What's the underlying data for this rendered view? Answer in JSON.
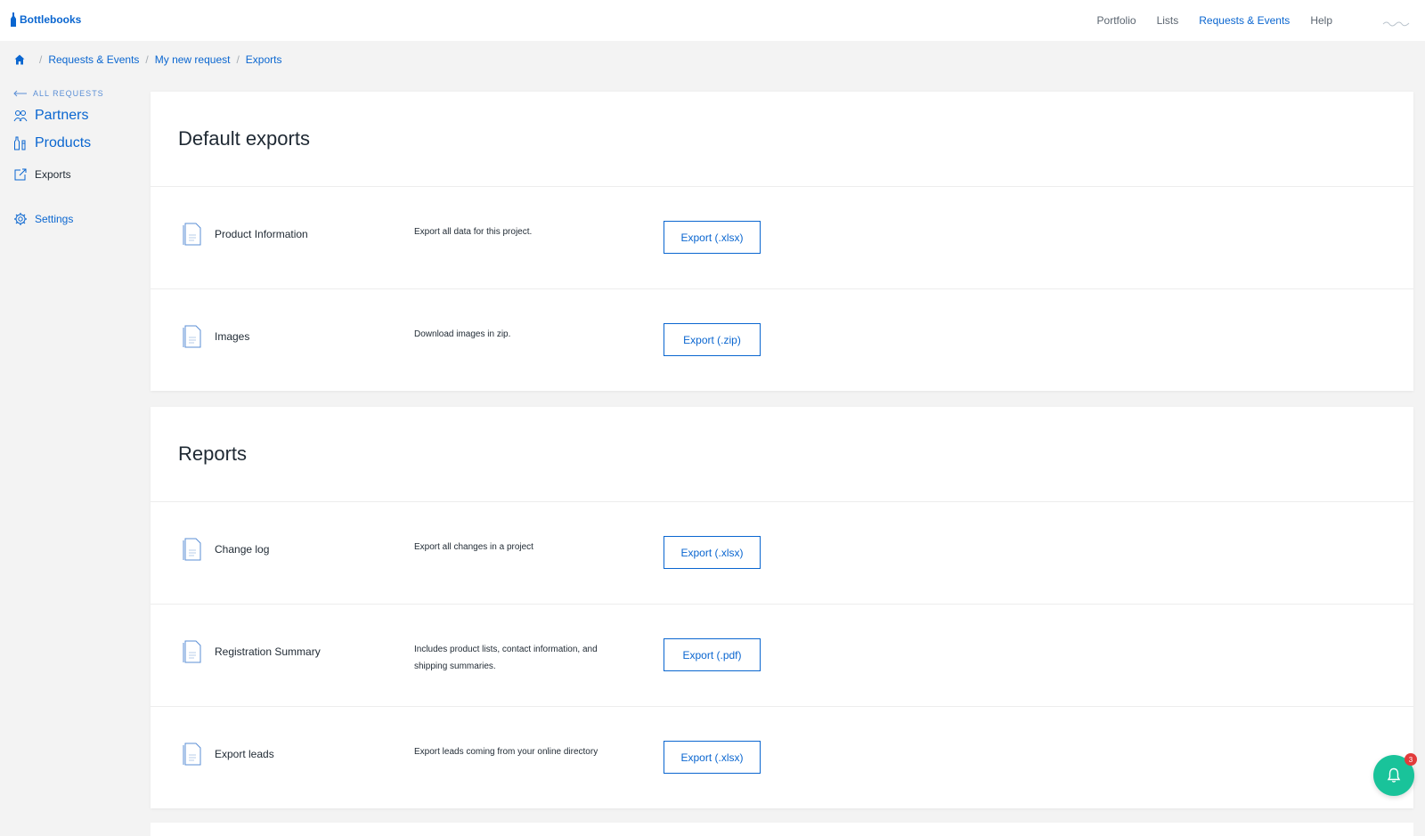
{
  "brand": {
    "name": "Bottlebooks"
  },
  "nav": {
    "items": [
      {
        "label": "Portfolio",
        "active": false
      },
      {
        "label": "Lists",
        "active": false
      },
      {
        "label": "Requests & Events",
        "active": true
      },
      {
        "label": "Help",
        "active": false
      }
    ]
  },
  "breadcrumb": {
    "items": [
      "Requests & Events",
      "My new request",
      "Exports"
    ]
  },
  "sidebar": {
    "back_label": "ALL REQUESTS",
    "items": [
      {
        "label": "Partners",
        "icon": "users-icon"
      },
      {
        "label": "Products",
        "icon": "bottles-icon"
      },
      {
        "label": "Exports",
        "icon": "export-icon"
      },
      {
        "label": "Settings",
        "icon": "gear-icon"
      }
    ]
  },
  "sections": [
    {
      "title": "Default exports",
      "rows": [
        {
          "name": "Product Information",
          "desc": "Export all data for this project.",
          "button": "Export (.xlsx)"
        },
        {
          "name": "Images",
          "desc": "Download images in zip.",
          "button": "Export (.zip)"
        }
      ]
    },
    {
      "title": "Reports",
      "rows": [
        {
          "name": "Change log",
          "desc": "Export all changes in a project",
          "button": "Export (.xlsx)"
        },
        {
          "name": "Registration Summary",
          "desc": "Includes product lists, contact information, and shipping summaries.",
          "button": "Export (.pdf)"
        },
        {
          "name": "Export leads",
          "desc": "Export leads coming from your online directory",
          "button": "Export (.xlsx)"
        }
      ]
    }
  ],
  "notifications": {
    "count": "3"
  },
  "colors": {
    "accent": "#0a66d0",
    "notify": "#19c39a",
    "badge": "#e23b3b"
  }
}
